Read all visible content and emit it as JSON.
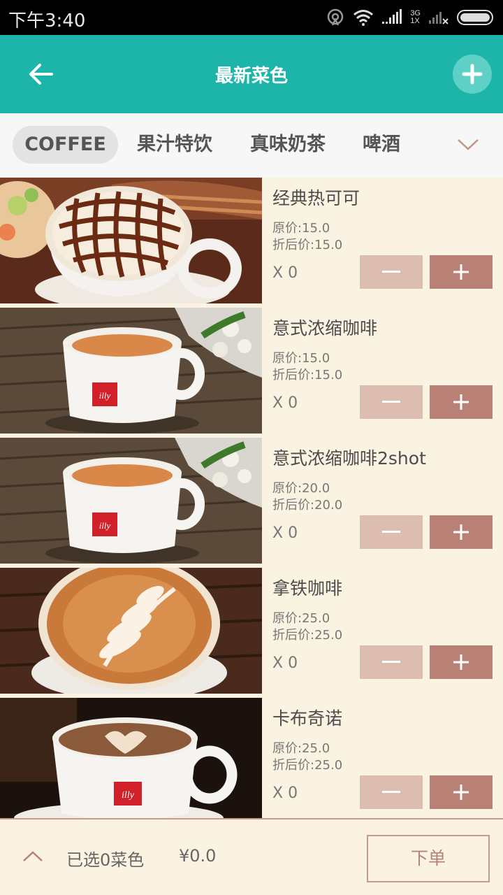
{
  "status_bar": {
    "time": "下午3:40",
    "network_top": "3G",
    "network_bottom": "1X"
  },
  "app_bar": {
    "title": "最新菜色",
    "back_icon": "arrow-left-icon",
    "add_icon": "plus-icon"
  },
  "tabs": [
    {
      "label": "COFFEE",
      "active": true
    },
    {
      "label": "果汁特饮",
      "active": false
    },
    {
      "label": "真味奶茶",
      "active": false
    },
    {
      "label": "啤酒",
      "active": false
    }
  ],
  "items": [
    {
      "name": "经典热可可",
      "original": "原价:15.0",
      "discount": "折后价:15.0",
      "qty": "X 0"
    },
    {
      "name": "意式浓缩咖啡",
      "original": "原价:15.0",
      "discount": "折后价:15.0",
      "qty": "X 0"
    },
    {
      "name": "意式浓缩咖啡2shot",
      "original": "原价:20.0",
      "discount": "折后价:20.0",
      "qty": "X 0"
    },
    {
      "name": "拿铁咖啡",
      "original": "原价:25.0",
      "discount": "折后价:25.0",
      "qty": "X 0"
    },
    {
      "name": "卡布奇诺",
      "original": "原价:25.0",
      "discount": "折后价:25.0",
      "qty": "X 0"
    }
  ],
  "bottom": {
    "selected": "已选0菜色",
    "total": "¥0.0",
    "order": "下单"
  },
  "colors": {
    "accent": "#1db5a9",
    "minus_button": "#dcbdaf",
    "plus_button": "#b98176",
    "background": "#fbf3e1"
  }
}
